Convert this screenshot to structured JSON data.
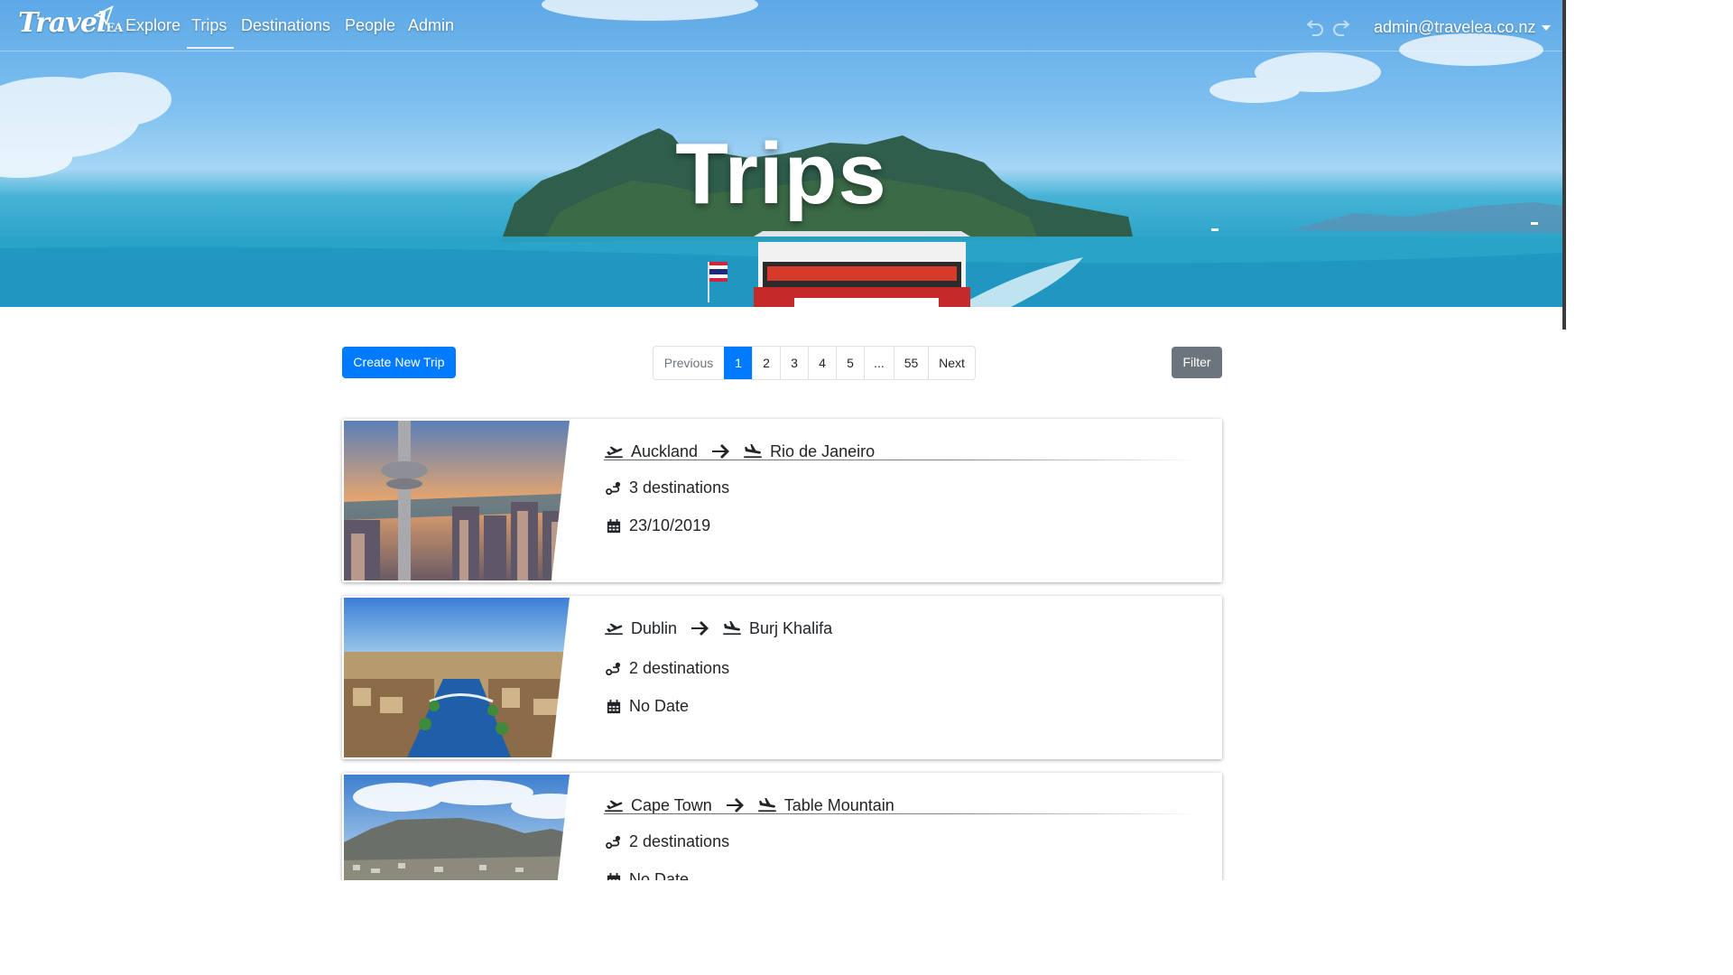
{
  "brand": {
    "name": "Travel",
    "suffix": "EA"
  },
  "nav": {
    "links": [
      {
        "label": "Explore"
      },
      {
        "label": "Trips"
      },
      {
        "label": "Destinations"
      },
      {
        "label": "People"
      },
      {
        "label": "Admin"
      }
    ],
    "active": "Trips",
    "user": "admin@travelea.co.nz"
  },
  "hero": {
    "title": "Trips"
  },
  "toolbar": {
    "create_label": "Create New Trip",
    "filter_label": "Filter"
  },
  "pagination": {
    "previous": "Previous",
    "pages": [
      "1",
      "2",
      "3",
      "4",
      "5",
      "...",
      "55"
    ],
    "next": "Next",
    "current": "1"
  },
  "trips": [
    {
      "from": "Auckland",
      "to": "Rio de Janeiro",
      "destinations": "3 destinations",
      "date": "23/10/2019",
      "image": "auckland-sky-tower"
    },
    {
      "from": "Dublin",
      "to": "Burj Khalifa",
      "destinations": "2 destinations",
      "date": "No Date",
      "image": "dublin-river"
    },
    {
      "from": "Cape Town",
      "to": "Table Mountain",
      "destinations": "2 destinations",
      "date": "No Date",
      "image": "table-mountain"
    }
  ],
  "icons": {
    "takeoff": "plane-departure-icon",
    "landing": "plane-arrival-icon",
    "arrow": "arrow-right-icon",
    "route": "route-icon",
    "calendar": "calendar-icon",
    "undo": "undo-icon",
    "redo": "redo-icon"
  },
  "colors": {
    "primary": "#007bff",
    "secondary": "#6c757d"
  }
}
